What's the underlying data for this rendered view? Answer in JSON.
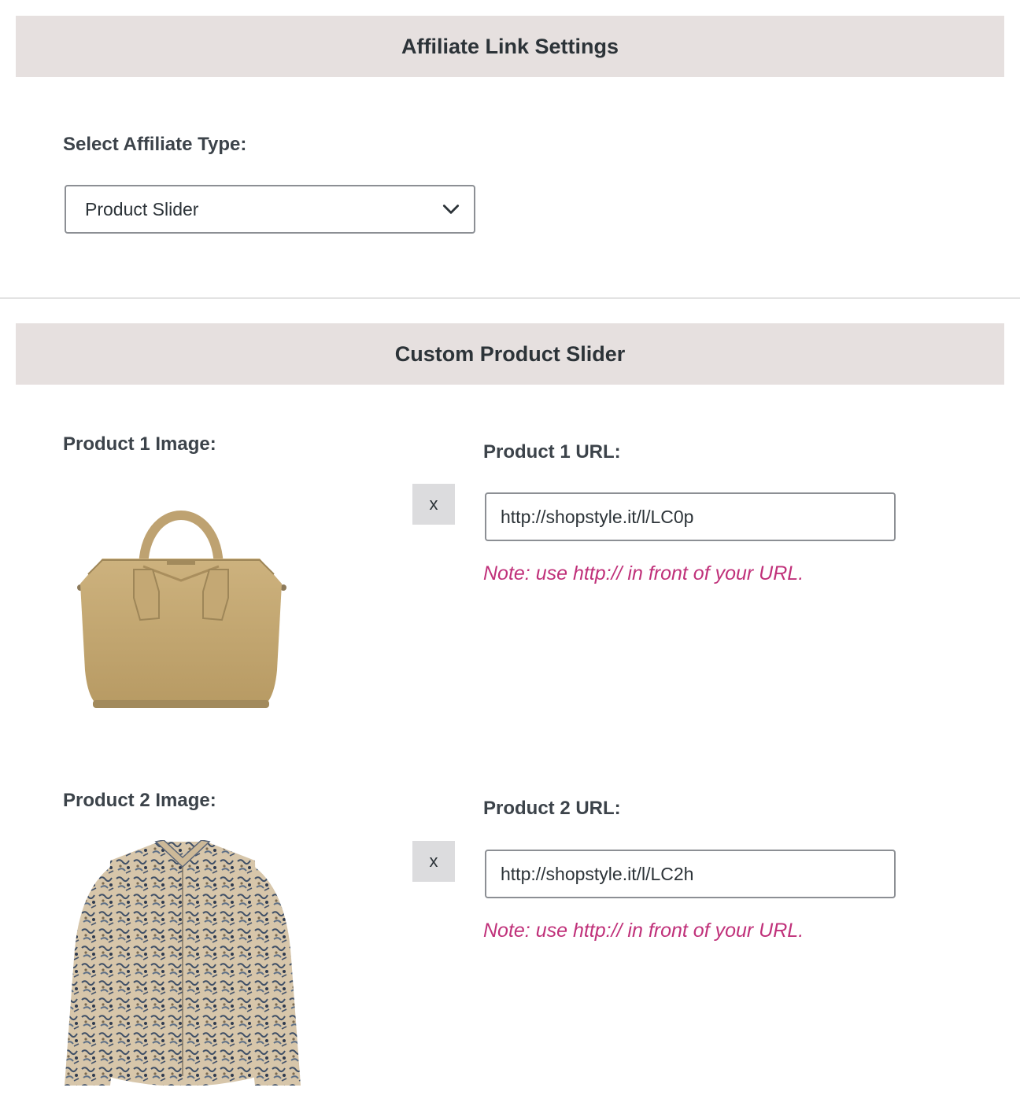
{
  "affiliate_settings": {
    "header": "Affiliate Link Settings",
    "select_label": "Select Affiliate Type:",
    "select_value": "Product Slider"
  },
  "custom_slider": {
    "header": "Custom Product Slider",
    "products": [
      {
        "image_label": "Product 1 Image:",
        "url_label": "Product 1 URL:",
        "remove_label": "x",
        "url_value": "http://shopstyle.it/l/LC0p",
        "note": "Note: use http:// in front of your URL.",
        "image_subject": "beige-leather-handbag"
      },
      {
        "image_label": "Product 2 Image:",
        "url_label": "Product 2 URL:",
        "remove_label": "x",
        "url_value": "http://shopstyle.it/l/LC2h",
        "note": "Note: use http:// in front of your URL.",
        "image_subject": "printed-floral-blouse"
      }
    ]
  },
  "colors": {
    "header_bg": "#e6e0df",
    "note": "#c0317a",
    "remove_button_bg": "#dcdcde",
    "input_border": "#8c8f94"
  }
}
